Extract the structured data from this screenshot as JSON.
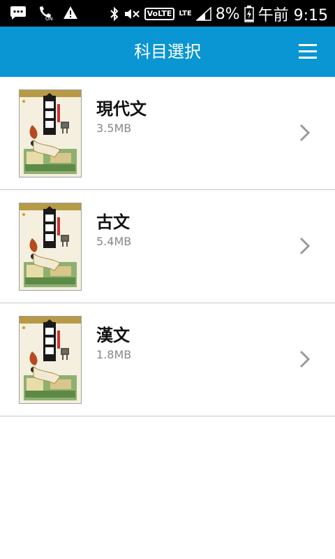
{
  "status_bar": {
    "battery": "8%",
    "time": "午前 9:15",
    "volte_label": "VoLTE",
    "lte_label": "LTE"
  },
  "header": {
    "title": "科目選択",
    "menu_icon": "hamburger-menu-icon"
  },
  "subjects": [
    {
      "title": "現代文",
      "size": "3.5MB"
    },
    {
      "title": "古文",
      "size": "5.4MB"
    },
    {
      "title": "漢文",
      "size": "1.8MB"
    }
  ],
  "colors": {
    "header_bg": "#0a95d3",
    "status_bar_bg": "#000000",
    "divider": "#c8c8c8",
    "chevron": "#9a9a9a"
  }
}
